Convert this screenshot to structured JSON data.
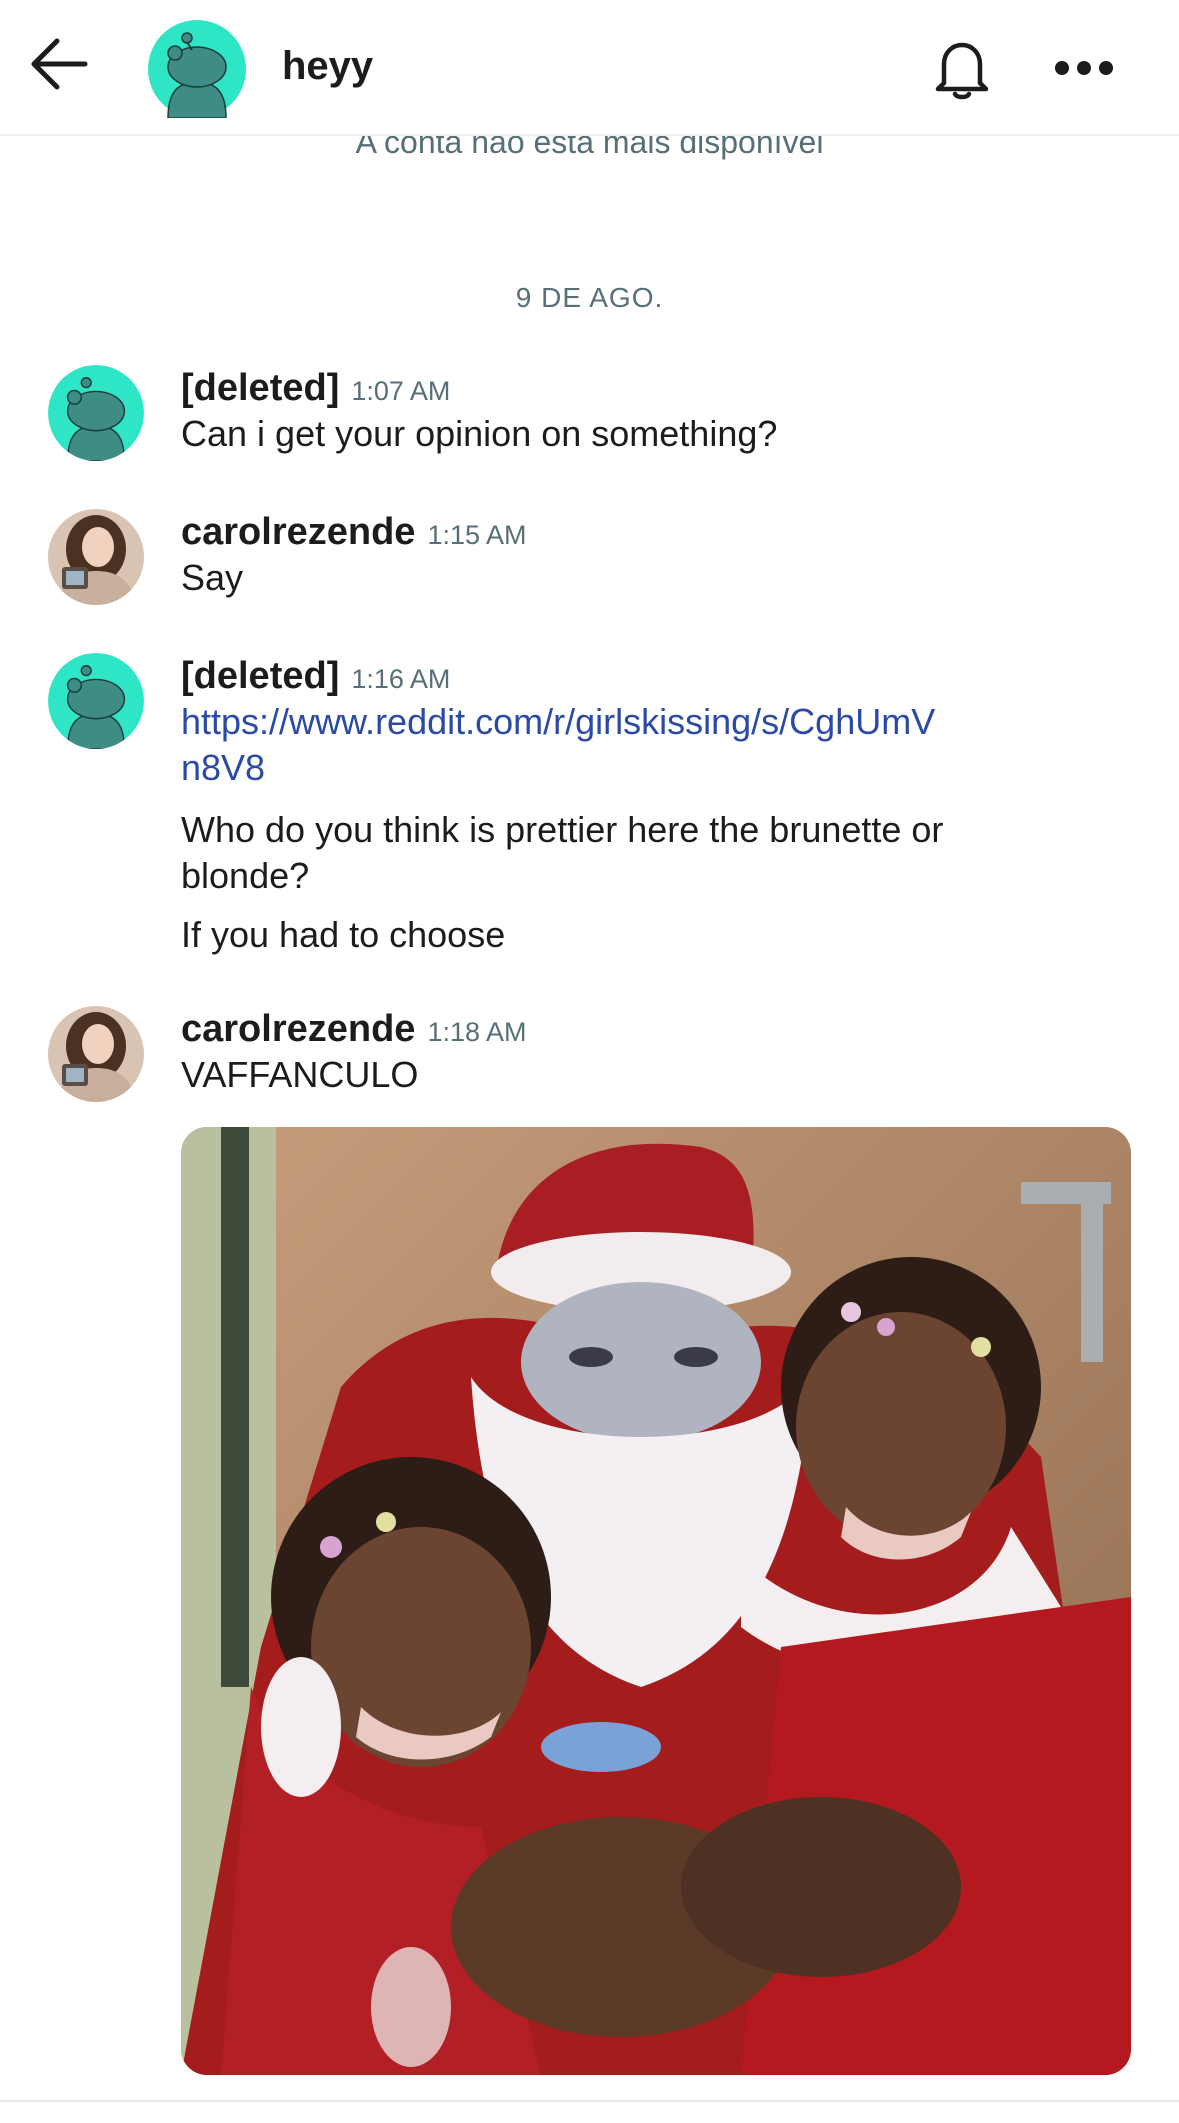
{
  "header": {
    "title": "heyy",
    "back_icon": "arrow-left-icon",
    "bell_icon": "bell-icon",
    "more_icon": "more-horizontal-icon"
  },
  "notice": "A conta não está mais disponível",
  "date_separator": "9 DE AGO.",
  "messages": [
    {
      "user": "[deleted]",
      "time": "1:07 AM",
      "avatar": "snoo-avatar",
      "lines": [
        "Can i get your opinion on something?"
      ]
    },
    {
      "user": "carolrezende",
      "time": "1:15 AM",
      "avatar": "user-photo-avatar",
      "lines": [
        "Say"
      ]
    },
    {
      "user": "[deleted]",
      "time": "1:16 AM",
      "avatar": "snoo-avatar",
      "link": "https://www.reddit.com/r/girlskissing/s/CghUmVn8V8",
      "lines": [
        "Who do you think is prettier here the brunette or blonde?",
        "If you had to choose"
      ]
    },
    {
      "user": "carolrezende",
      "time": "1:18 AM",
      "avatar": "user-photo-avatar",
      "lines": [
        "VAFFANCULO"
      ],
      "attachment": "santa-photo-image"
    }
  ],
  "colors": {
    "snoo_teal": "#2ee6c5",
    "link_blue": "#2a4aa6",
    "meta_gray": "#576f76"
  }
}
